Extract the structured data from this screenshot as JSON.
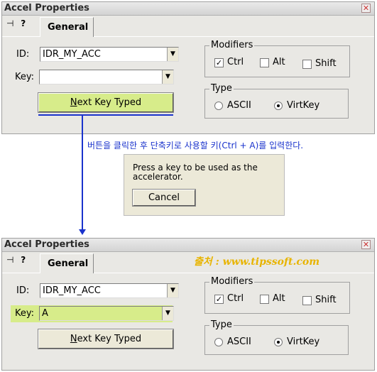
{
  "window_title": "Accel Properties",
  "close_glyph": "✕",
  "pin_glyph": "⊣",
  "help_glyph": "?",
  "tab_general": "General",
  "id_label": "ID:",
  "key_label": "Key:",
  "modifiers_title": "Modifiers",
  "ctrl": "Ctrl",
  "alt": "Alt",
  "shift": "Shift",
  "type_title": "Type",
  "ascii": "ASCII",
  "virtkey": "VirtKey",
  "top": {
    "id_value": "IDR_MY_ACC",
    "key_value": "",
    "next_key_prefix": "N",
    "next_key_rest": "ext Key Typed"
  },
  "annotation_text": "버튼을 클릭한 후 단축키로 사용할 키(Ctrl + A)를 입력한다.",
  "popup": {
    "message": "Press a key to be used as the accelerator.",
    "cancel": "Cancel"
  },
  "bottom": {
    "id_value": "IDR_MY_ACC",
    "key_value": "A",
    "next_key_prefix": "N",
    "next_key_rest": "ext Key Typed",
    "source_watermark": "출처 : www.tipssoft.com"
  },
  "colors": {
    "highlight": "#d7ec8a",
    "annotation_blue": "#1a33cc",
    "watermark": "#e8b400"
  }
}
